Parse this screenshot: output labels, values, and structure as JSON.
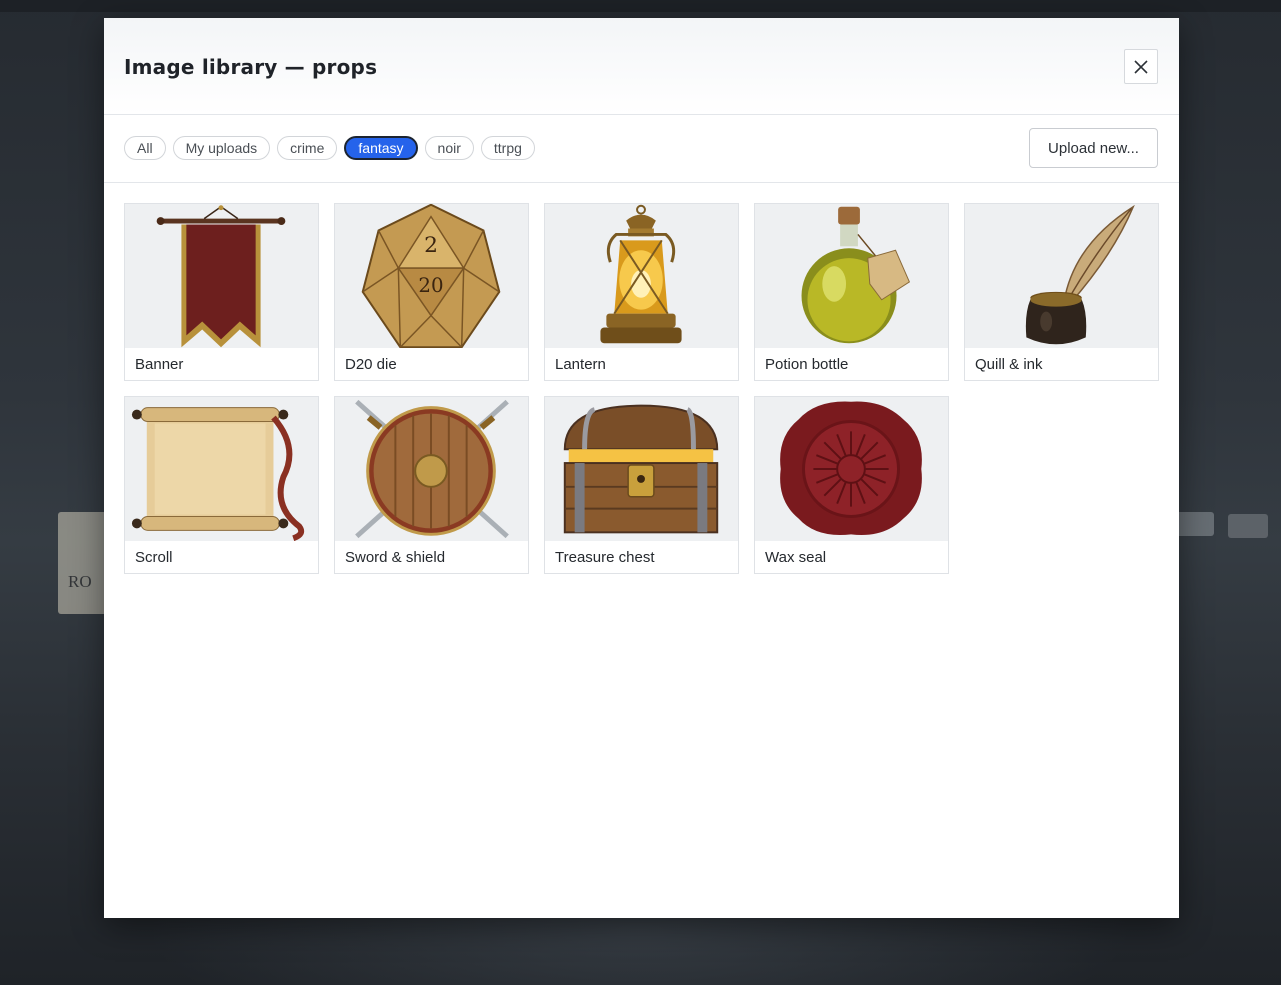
{
  "modal": {
    "title": "Image library — props",
    "close_icon": "close-icon"
  },
  "filters": [
    {
      "label": "All",
      "active": false
    },
    {
      "label": "My uploads",
      "active": false
    },
    {
      "label": "crime",
      "active": false
    },
    {
      "label": "fantasy",
      "active": true
    },
    {
      "label": "noir",
      "active": false
    },
    {
      "label": "ttrpg",
      "active": false
    }
  ],
  "upload_label": "Upload new...",
  "accent_color": "#2563eb",
  "items": [
    {
      "label": "Banner",
      "icon": "banner-image"
    },
    {
      "label": "D20 die",
      "icon": "d20-image"
    },
    {
      "label": "Lantern",
      "icon": "lantern-image"
    },
    {
      "label": "Potion bottle",
      "icon": "potion-image"
    },
    {
      "label": "Quill & ink",
      "icon": "quill-image"
    },
    {
      "label": "Scroll",
      "icon": "scroll-image"
    },
    {
      "label": "Sword & shield",
      "icon": "sword-shield-image"
    },
    {
      "label": "Treasure chest",
      "icon": "chest-image"
    },
    {
      "label": "Wax seal",
      "icon": "wax-seal-image"
    }
  ]
}
